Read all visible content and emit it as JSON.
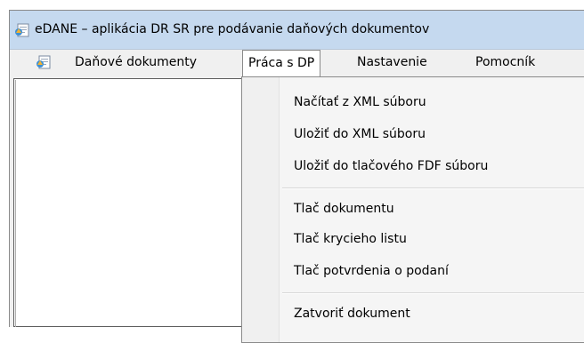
{
  "window": {
    "title": "eDANE – aplikácia DR SR pre podávanie daňových dokumentov",
    "icon": "edane-app-icon"
  },
  "menubar": {
    "icon": "edane-app-icon",
    "items": [
      {
        "label": "Daňové dokumenty"
      },
      {
        "label": "Práca s DP",
        "active": true
      },
      {
        "label": "Nastavenie"
      },
      {
        "label": "Pomocník"
      }
    ]
  },
  "dropdown": {
    "groups": [
      [
        "Načítať z XML súboru",
        "Uložiť do XML súboru",
        "Uložiť do tlačového FDF súboru"
      ],
      [
        "Tlač dokumentu",
        "Tlač krycieho listu",
        "Tlač potvrdenia o podaní"
      ],
      [
        "Zatvoriť dokument"
      ]
    ]
  },
  "colors": {
    "titlebar": "#c5d9ef",
    "menubar": "#f0f0f0",
    "dropdown_bg": "#f5f5f5"
  }
}
